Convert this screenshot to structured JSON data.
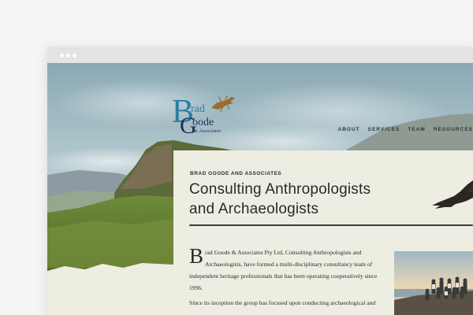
{
  "site": {
    "logo_text": "Brad Goode & Associates",
    "nav": [
      {
        "label": "ABOUT"
      },
      {
        "label": "SERVICES"
      },
      {
        "label": "TEAM"
      },
      {
        "label": "RESOURCES"
      }
    ]
  },
  "intro": {
    "eyebrow": "BRAD GOODE AND ASSOCIATES",
    "title_line1": "Consulting Anthropologists",
    "title_line2": "and Archaeologists",
    "drop_cap": "B",
    "paragraph1": "rad Goode & Associates Pty Ltd, Consulting Anthropologists and Archaeologists, have formed a multi-disciplinary consultancy team of independent heritage professionals that has been operating cooperatively since 1996.",
    "paragraph2": "Since its inception the group has focused upon conducting archaeological and"
  },
  "colors": {
    "panel_bg": "#eeede2",
    "logo_blue": "#2a7fa3",
    "logo_navy": "#1f2f5a",
    "nav_text": "#2c3a3a"
  }
}
